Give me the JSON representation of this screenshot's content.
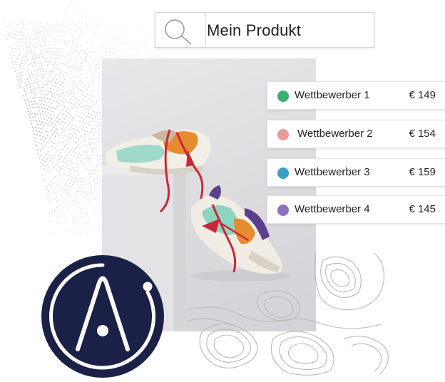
{
  "search": {
    "text": "Mein Produkt",
    "icon": "search-icon"
  },
  "competitors": [
    {
      "name": "Wettbewerber 1",
      "price": "€ 149",
      "color": "#3aaf72"
    },
    {
      "name": "Wettbewerber 2",
      "price": "€ 154",
      "color": "#e79a98"
    },
    {
      "name": "Wettbewerber 3",
      "price": "€ 159",
      "color": "#3b9fbf"
    },
    {
      "name": "Wettbewerber 4",
      "price": "€ 145",
      "color": "#8b71c0"
    }
  ],
  "colors": {
    "logo_navy": "#1b2146",
    "topo_line": "#b9b9b9",
    "dots": "#a8a8a8"
  },
  "logo": {
    "icon": "brand-logo-icon"
  }
}
